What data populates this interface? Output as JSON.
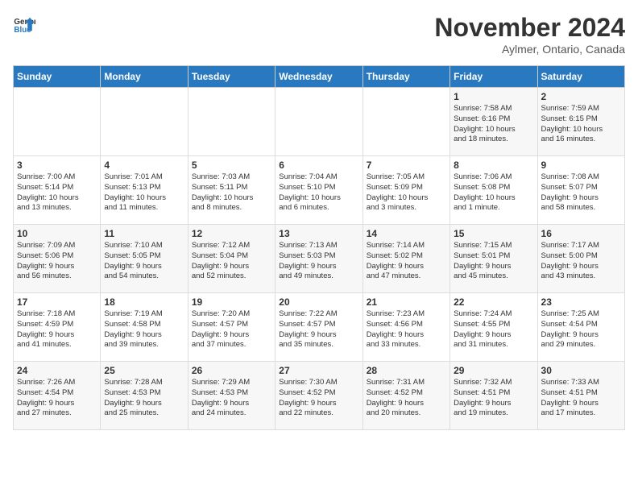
{
  "header": {
    "logo_line1": "General",
    "logo_line2": "Blue",
    "month_year": "November 2024",
    "location": "Aylmer, Ontario, Canada"
  },
  "weekdays": [
    "Sunday",
    "Monday",
    "Tuesday",
    "Wednesday",
    "Thursday",
    "Friday",
    "Saturday"
  ],
  "weeks": [
    [
      {
        "day": "",
        "info": ""
      },
      {
        "day": "",
        "info": ""
      },
      {
        "day": "",
        "info": ""
      },
      {
        "day": "",
        "info": ""
      },
      {
        "day": "",
        "info": ""
      },
      {
        "day": "1",
        "info": "Sunrise: 7:58 AM\nSunset: 6:16 PM\nDaylight: 10 hours\nand 18 minutes."
      },
      {
        "day": "2",
        "info": "Sunrise: 7:59 AM\nSunset: 6:15 PM\nDaylight: 10 hours\nand 16 minutes."
      }
    ],
    [
      {
        "day": "3",
        "info": "Sunrise: 7:00 AM\nSunset: 5:14 PM\nDaylight: 10 hours\nand 13 minutes."
      },
      {
        "day": "4",
        "info": "Sunrise: 7:01 AM\nSunset: 5:13 PM\nDaylight: 10 hours\nand 11 minutes."
      },
      {
        "day": "5",
        "info": "Sunrise: 7:03 AM\nSunset: 5:11 PM\nDaylight: 10 hours\nand 8 minutes."
      },
      {
        "day": "6",
        "info": "Sunrise: 7:04 AM\nSunset: 5:10 PM\nDaylight: 10 hours\nand 6 minutes."
      },
      {
        "day": "7",
        "info": "Sunrise: 7:05 AM\nSunset: 5:09 PM\nDaylight: 10 hours\nand 3 minutes."
      },
      {
        "day": "8",
        "info": "Sunrise: 7:06 AM\nSunset: 5:08 PM\nDaylight: 10 hours\nand 1 minute."
      },
      {
        "day": "9",
        "info": "Sunrise: 7:08 AM\nSunset: 5:07 PM\nDaylight: 9 hours\nand 58 minutes."
      }
    ],
    [
      {
        "day": "10",
        "info": "Sunrise: 7:09 AM\nSunset: 5:06 PM\nDaylight: 9 hours\nand 56 minutes."
      },
      {
        "day": "11",
        "info": "Sunrise: 7:10 AM\nSunset: 5:05 PM\nDaylight: 9 hours\nand 54 minutes."
      },
      {
        "day": "12",
        "info": "Sunrise: 7:12 AM\nSunset: 5:04 PM\nDaylight: 9 hours\nand 52 minutes."
      },
      {
        "day": "13",
        "info": "Sunrise: 7:13 AM\nSunset: 5:03 PM\nDaylight: 9 hours\nand 49 minutes."
      },
      {
        "day": "14",
        "info": "Sunrise: 7:14 AM\nSunset: 5:02 PM\nDaylight: 9 hours\nand 47 minutes."
      },
      {
        "day": "15",
        "info": "Sunrise: 7:15 AM\nSunset: 5:01 PM\nDaylight: 9 hours\nand 45 minutes."
      },
      {
        "day": "16",
        "info": "Sunrise: 7:17 AM\nSunset: 5:00 PM\nDaylight: 9 hours\nand 43 minutes."
      }
    ],
    [
      {
        "day": "17",
        "info": "Sunrise: 7:18 AM\nSunset: 4:59 PM\nDaylight: 9 hours\nand 41 minutes."
      },
      {
        "day": "18",
        "info": "Sunrise: 7:19 AM\nSunset: 4:58 PM\nDaylight: 9 hours\nand 39 minutes."
      },
      {
        "day": "19",
        "info": "Sunrise: 7:20 AM\nSunset: 4:57 PM\nDaylight: 9 hours\nand 37 minutes."
      },
      {
        "day": "20",
        "info": "Sunrise: 7:22 AM\nSunset: 4:57 PM\nDaylight: 9 hours\nand 35 minutes."
      },
      {
        "day": "21",
        "info": "Sunrise: 7:23 AM\nSunset: 4:56 PM\nDaylight: 9 hours\nand 33 minutes."
      },
      {
        "day": "22",
        "info": "Sunrise: 7:24 AM\nSunset: 4:55 PM\nDaylight: 9 hours\nand 31 minutes."
      },
      {
        "day": "23",
        "info": "Sunrise: 7:25 AM\nSunset: 4:54 PM\nDaylight: 9 hours\nand 29 minutes."
      }
    ],
    [
      {
        "day": "24",
        "info": "Sunrise: 7:26 AM\nSunset: 4:54 PM\nDaylight: 9 hours\nand 27 minutes."
      },
      {
        "day": "25",
        "info": "Sunrise: 7:28 AM\nSunset: 4:53 PM\nDaylight: 9 hours\nand 25 minutes."
      },
      {
        "day": "26",
        "info": "Sunrise: 7:29 AM\nSunset: 4:53 PM\nDaylight: 9 hours\nand 24 minutes."
      },
      {
        "day": "27",
        "info": "Sunrise: 7:30 AM\nSunset: 4:52 PM\nDaylight: 9 hours\nand 22 minutes."
      },
      {
        "day": "28",
        "info": "Sunrise: 7:31 AM\nSunset: 4:52 PM\nDaylight: 9 hours\nand 20 minutes."
      },
      {
        "day": "29",
        "info": "Sunrise: 7:32 AM\nSunset: 4:51 PM\nDaylight: 9 hours\nand 19 minutes."
      },
      {
        "day": "30",
        "info": "Sunrise: 7:33 AM\nSunset: 4:51 PM\nDaylight: 9 hours\nand 17 minutes."
      }
    ]
  ]
}
